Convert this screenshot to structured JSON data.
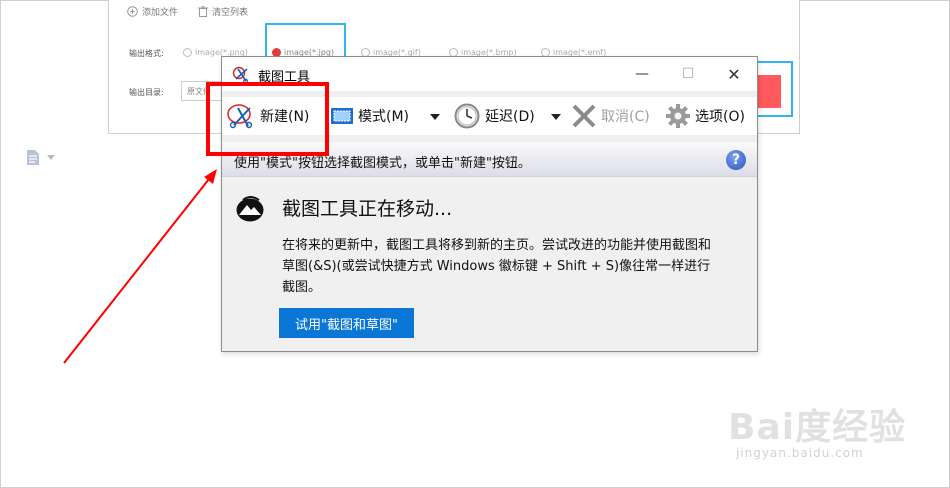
{
  "background_app": {
    "add_file": "添加文件",
    "clear_list": "清空列表",
    "output_format_label": "输出格式:",
    "formats": [
      "image(*.png)",
      "image(*.jpg)",
      "image(*.gif)",
      "image(*.bmp)",
      "image(*.emf)"
    ],
    "output_dir_label": "输出目录:",
    "output_dir_value": "原文件"
  },
  "snipping_tool": {
    "title": "截图工具",
    "window_controls": {
      "minimize": "—",
      "maximize": "☐",
      "close": "✕"
    },
    "toolbar": {
      "new_label": "新建(N)",
      "mode_label": "模式(M)",
      "delay_label": "延迟(D)",
      "cancel_label": "取消(C)",
      "options_label": "选项(O)"
    },
    "info_text": "使用\"模式\"按钮选择截图模式，或单击\"新建\"按钮。",
    "help_glyph": "?",
    "move_title": "截图工具正在移动...",
    "move_body": "在将来的更新中，截图工具将移到新的主页。尝试改进的功能并使用截图和草图(&S)(或尝试快捷方式 Windows 徽标键 + Shift + S)像往常一样进行截图。",
    "try_button": "试用\"截图和草图\""
  },
  "watermark": {
    "brand": "Bai度经验",
    "url": "jingyan.baidu.com"
  },
  "colors": {
    "accent_blue": "#0a76d6",
    "highlight_red": "#ff0000",
    "cyan_frame": "#2fb6ee"
  }
}
